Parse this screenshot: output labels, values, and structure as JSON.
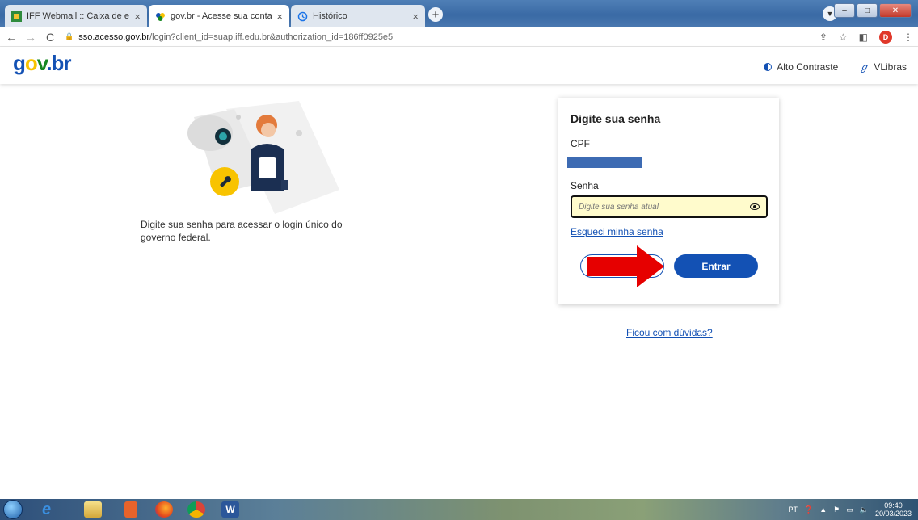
{
  "browser": {
    "tabs": [
      {
        "title": "IFF Webmail :: Caixa de entrada",
        "active": false
      },
      {
        "title": "gov.br - Acesse sua conta",
        "active": true
      },
      {
        "title": "Histórico",
        "active": false
      }
    ],
    "url_host": "sso.acesso.gov.br",
    "url_path": "/login?client_id=suap.iff.edu.br&authorization_id=186ff0925e5",
    "profile_initial": "D"
  },
  "header": {
    "logo": {
      "g": "g",
      "o": "o",
      "v": "v",
      "dot": ".",
      "br": "br"
    },
    "contrast_label": "Alto Contraste",
    "vlibras_label": "VLibras"
  },
  "intro": {
    "text": "Digite sua senha para acessar o login único do governo federal."
  },
  "login": {
    "title": "Digite sua senha",
    "cpf_label": "CPF",
    "password_label": "Senha",
    "password_placeholder": "Digite sua senha atual",
    "forgot_link": "Esqueci minha senha",
    "cancel_label": "",
    "enter_label": "Entrar"
  },
  "help_link": "Ficou com dúvidas?",
  "taskbar": {
    "language": "PT",
    "time": "09:40",
    "date": "20/03/2023"
  },
  "colors": {
    "brand_blue": "#1351b4",
    "annotation_arrow": "#e60000",
    "password_bg": "#fffbcc"
  }
}
